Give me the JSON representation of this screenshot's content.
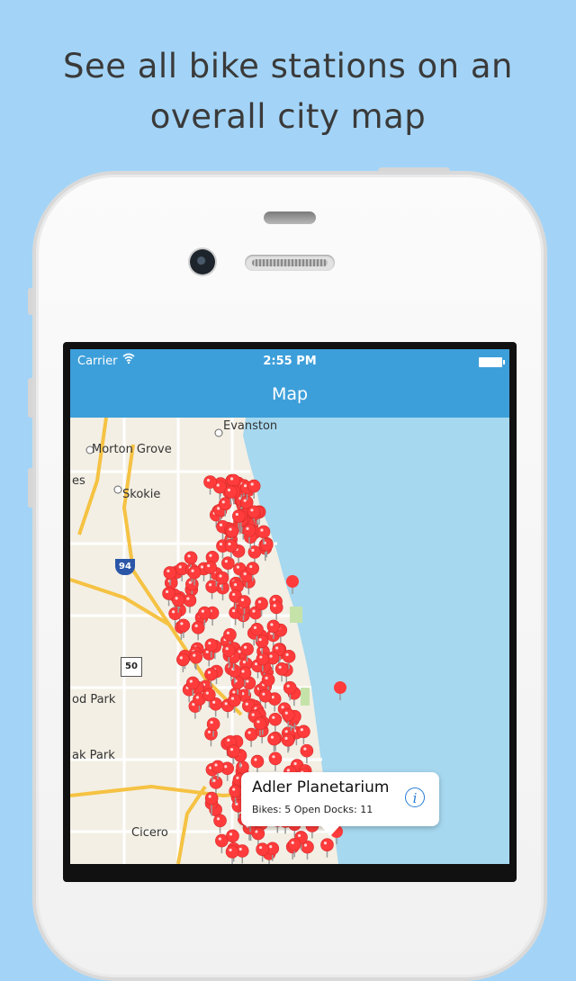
{
  "headline": {
    "line1": "See all bike stations on an",
    "line2": "overall city map"
  },
  "status_bar": {
    "carrier": "Carrier",
    "time": "2:55 PM",
    "wifi_icon": "wifi-icon",
    "battery_icon": "battery-icon"
  },
  "nav": {
    "title": "Map"
  },
  "map": {
    "labels": {
      "evanston": "Evanston",
      "morton_grove": "Morton Grove",
      "es": "es",
      "skokie": "Skokie",
      "od_park": "od Park",
      "ak_park": "ak Park",
      "cicero": "Cicero"
    },
    "shields": {
      "i94": "94",
      "us50": "50"
    },
    "pin_color": "#ff3b3b",
    "water_color": "#a6d8ef",
    "land_color": "#f3efe4"
  },
  "callout": {
    "title": "Adler Planetarium",
    "subtitle": "Bikes: 5 Open Docks: 11",
    "info_icon": "info-icon"
  },
  "colors": {
    "background": "#a3d4f7",
    "nav_bar": "#3d9fda",
    "accent": "#2a7fd6"
  }
}
